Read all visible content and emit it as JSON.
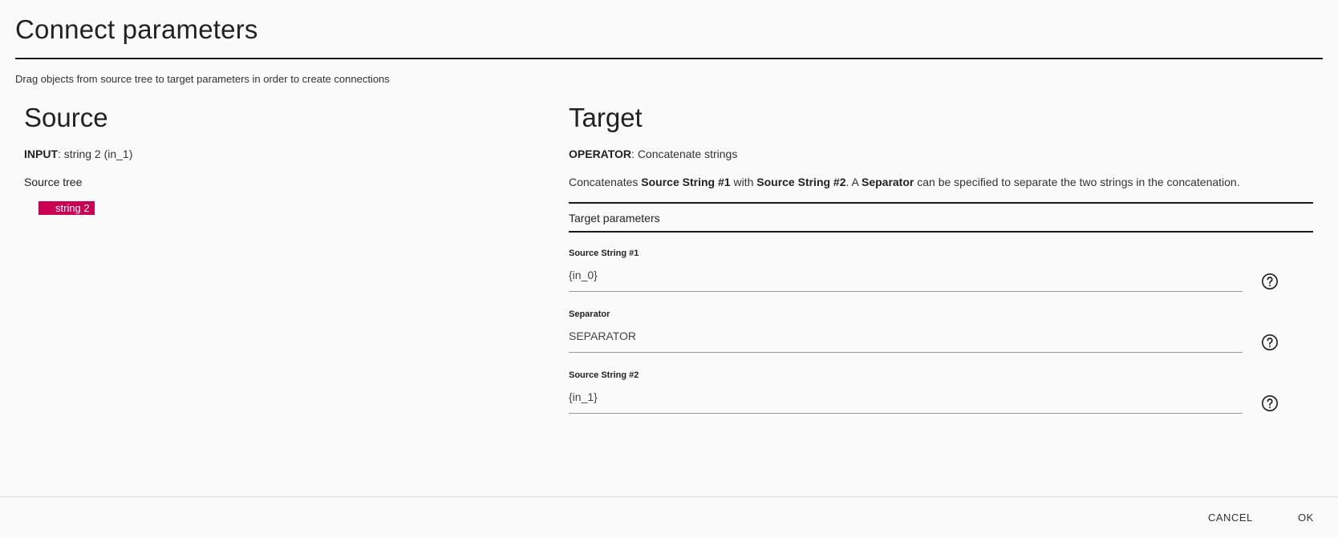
{
  "dialog": {
    "title": "Connect parameters",
    "instructions": "Drag objects from source tree to target parameters in order to create connections"
  },
  "source": {
    "heading": "Source",
    "input_label": "INPUT",
    "input_value": ": string 2 (in_1)",
    "tree_label": "Source tree",
    "tree_items": [
      {
        "label": "string 2",
        "color": "#cc0050"
      }
    ]
  },
  "target": {
    "heading": "Target",
    "operator_label": "OPERATOR",
    "operator_value": ": Concatenate strings",
    "description": {
      "p1": "Concatenates ",
      "b1": "Source String #1",
      "p2": " with ",
      "b2": "Source String #2",
      "p3": ". A ",
      "b3": "Separator",
      "p4": " can be specified to separate the two strings in the concatenation."
    },
    "params_header": "Target parameters",
    "params": [
      {
        "label": "Source String #1",
        "value": "{in_0}",
        "icon": "help-circle-icon"
      },
      {
        "label": "Separator",
        "value": "SEPARATOR",
        "icon": "help-circle-icon"
      },
      {
        "label": "Source String #2",
        "value": "{in_1}",
        "icon": "help-circle-icon"
      }
    ]
  },
  "footer": {
    "cancel_label": "CANCEL",
    "ok_label": "OK"
  },
  "colors": {
    "accent": "#cc0050",
    "background": "#fafafa"
  }
}
